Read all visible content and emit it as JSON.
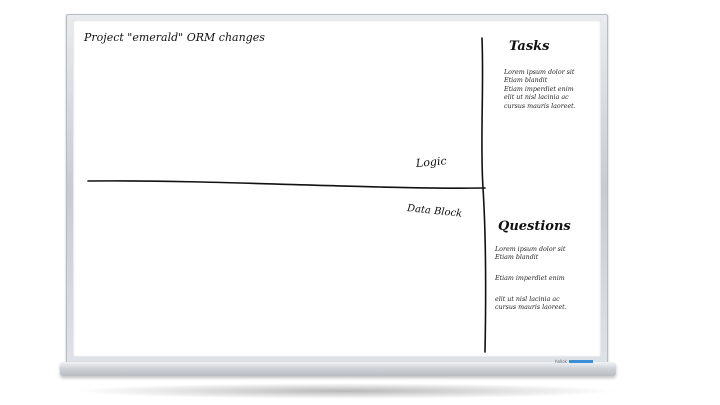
{
  "board": {
    "title": "Project \"emerald\" ORM changes",
    "logic_label": "Logic",
    "data_block_label": "Data Block",
    "brand_label": "hallok"
  },
  "tasks": {
    "heading": "Tasks",
    "lines": [
      "Lorem ipsum dolor sit",
      "Etiam blandit",
      "Etiam imperdiet enim",
      "elit ut nisl lacinia ac",
      "cursus mauris laoreet."
    ]
  },
  "questions": {
    "heading": "Questions",
    "group1": [
      "Lorem ipsum dolor sit",
      "Etiam blandit"
    ],
    "group2": [
      "Etiam imperdiet enim"
    ],
    "group3": [
      "elit ut nisl lacinia ac",
      "cursus mauris laoreet."
    ]
  },
  "colors": {
    "ink": "#111111",
    "frame": "#c8ccd1",
    "brand_bar": "#3a8fd8"
  }
}
